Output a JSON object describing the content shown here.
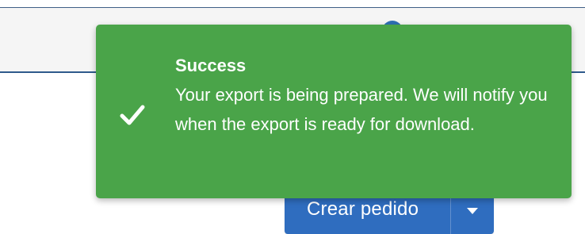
{
  "header": {
    "icons": [
      "help-icon",
      "user-icon",
      "notification-badge",
      "flag-icon"
    ]
  },
  "actions": {
    "create_order_label": "Crear pedido",
    "dropdown_icon": "chevron-down-icon"
  },
  "toast": {
    "type": "success",
    "icon": "checkmark-icon",
    "title": "Success",
    "message": "Your export is being prepared. We will notify you when the export is ready for download.",
    "colors": {
      "background": "#4aa449",
      "text": "#ffffff"
    }
  },
  "colors": {
    "primary_button": "#2f6dbf",
    "header_rule": "#2f5a8c"
  }
}
